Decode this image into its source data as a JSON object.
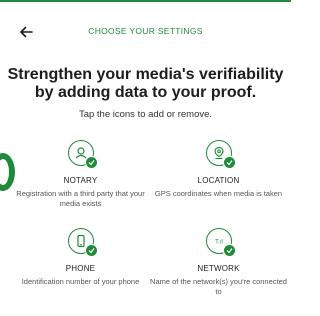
{
  "header": {
    "title": "CHOOSE YOUR SETTINGS"
  },
  "headline": "Strengthen your media's verifiability by adding data to your proof.",
  "subhead": "Tap the icons to add or remove.",
  "items": [
    {
      "title": "NOTARY",
      "description": "Registration with a third party that your media exists",
      "icon": "notary-icon",
      "enabled": true
    },
    {
      "title": "LOCATION",
      "description": "GPS coordinates when media is taken",
      "icon": "location-pin-icon",
      "enabled": true
    },
    {
      "title": "PHONE",
      "description": "Identification number of your phone",
      "icon": "phone-icon",
      "enabled": true
    },
    {
      "title": "NETWORK",
      "description": "Name of the network(s) you're connected to",
      "icon": "network-signal-icon",
      "enabled": true
    }
  ],
  "colors": {
    "accent": "#1f8a3b",
    "text": "#1d1d1d",
    "muted": "#555555"
  }
}
